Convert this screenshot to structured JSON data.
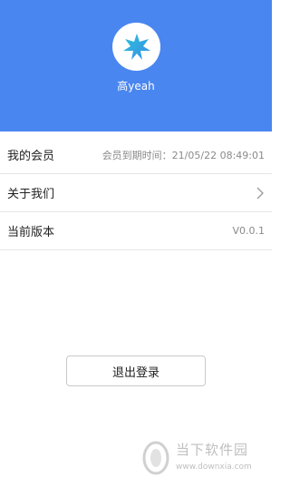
{
  "profile": {
    "username": "高yeah",
    "avatar_icon": "maple-leaf-icon",
    "header_color": "#4a86f0"
  },
  "menu": {
    "membership": {
      "label": "我的会员",
      "value": "会员到期时间：21/05/22 08:49:01"
    },
    "about": {
      "label": "关于我们",
      "icon": "chevron-right-icon"
    },
    "version": {
      "label": "当前版本",
      "value": "V0.0.1"
    }
  },
  "logout": {
    "label": "退出登录"
  },
  "watermark": {
    "title": "当下软件园",
    "url": "www.downxia.com"
  }
}
